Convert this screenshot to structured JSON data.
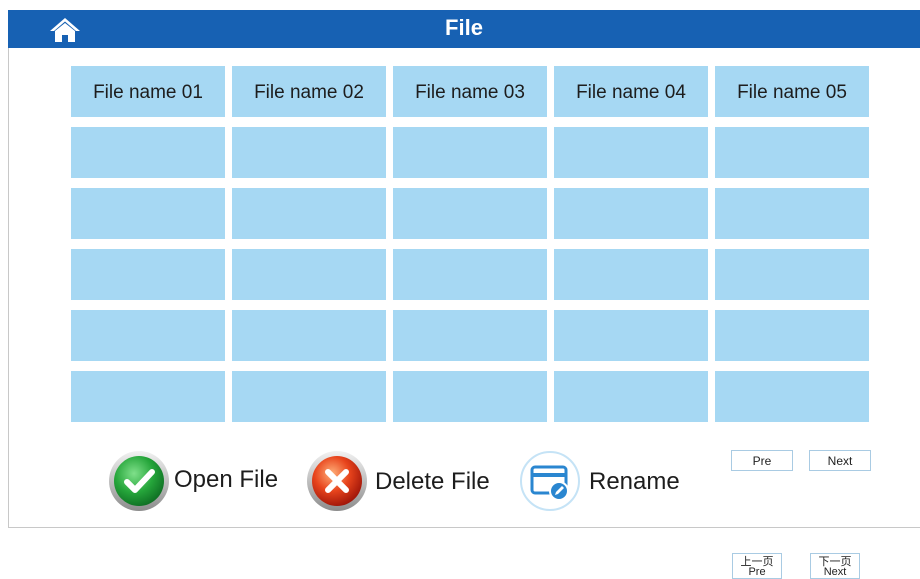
{
  "header": {
    "title": "File",
    "home_icon": "home-icon",
    "bar_color": "#1761b3"
  },
  "table": {
    "headers": [
      "File name 01",
      "File name 02",
      "File name 03",
      "File name 04",
      "File name 05"
    ],
    "cell_color": "#a6d8f3",
    "empty_rows": 5
  },
  "actions": {
    "open_label": "Open File",
    "delete_label": "Delete File",
    "rename_label": "Rename"
  },
  "pager": {
    "pre_label": "Pre",
    "next_label": "Next"
  },
  "bottom_pager": {
    "pre_cn": "上一页",
    "pre_en": "Pre",
    "next_cn": "下一页",
    "next_en": "Next"
  }
}
